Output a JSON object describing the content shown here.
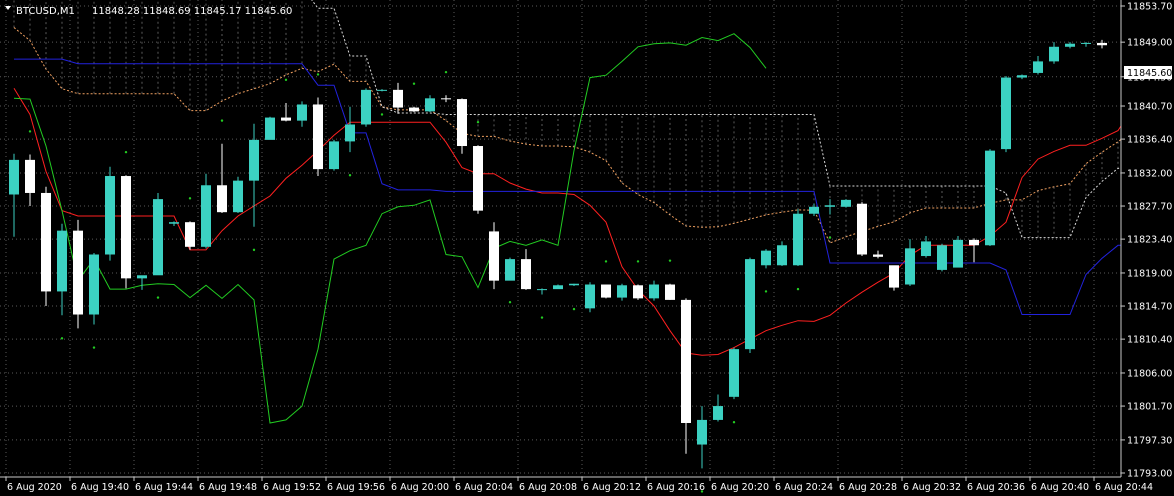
{
  "header": {
    "symbol": "BTCUSD,M1",
    "ohlc": "11848.28 11848.69 11845.17 11845.60"
  },
  "price_label": "11845.60",
  "colors": {
    "background": "#000000",
    "grid": "#5a5a5a",
    "bull_candle": "#3cd1c2",
    "bear_candle": "#ffffff",
    "tenkan": "#ff2020",
    "kijun": "#2222dd",
    "chikou": "#22cc22",
    "senkou_a": "#f0a060",
    "senkou_b": "#d8d8d8",
    "psar": "#22cc22"
  },
  "chart_data": {
    "type": "candlestick",
    "symbol": "BTCUSD",
    "timeframe": "M1",
    "indicators": [
      "Ichimoku Kinko Hyo",
      "Parabolic SAR"
    ],
    "ylim": [
      11793.0,
      11853.7
    ],
    "y_ticks": [
      "11853.70",
      "11849.00",
      "11845.60",
      "11844.50",
      "11840.70",
      "11836.40",
      "11832.00",
      "11827.70",
      "11823.40",
      "11819.00",
      "11814.70",
      "11810.40",
      "11806.00",
      "11801.70",
      "11797.30",
      "11793.00"
    ],
    "x_ticks": [
      "6 Aug 2020",
      "6 Aug 19:40",
      "6 Aug 19:44",
      "6 Aug 19:48",
      "6 Aug 19:52",
      "6 Aug 19:56",
      "6 Aug 20:00",
      "6 Aug 20:04",
      "6 Aug 20:08",
      "6 Aug 20:12",
      "6 Aug 20:16",
      "6 Aug 20:20",
      "6 Aug 20:24",
      "6 Aug 20:28",
      "6 Aug 20:32",
      "6 Aug 20:36",
      "6 Aug 20:40",
      "6 Aug 20:44"
    ],
    "candles": [
      {
        "o": 11829.2,
        "h": 11834.5,
        "l": 11823.7,
        "c": 11833.7
      },
      {
        "o": 11833.7,
        "h": 11834.4,
        "l": 11827.7,
        "c": 11829.4
      },
      {
        "o": 11829.4,
        "h": 11830.2,
        "l": 11814.7,
        "c": 11816.6
      },
      {
        "o": 11816.6,
        "h": 11825.4,
        "l": 11813.5,
        "c": 11824.5
      },
      {
        "o": 11824.5,
        "h": 11825.9,
        "l": 11811.8,
        "c": 11813.6
      },
      {
        "o": 11813.6,
        "h": 11821.6,
        "l": 11812.3,
        "c": 11821.4
      },
      {
        "o": 11821.4,
        "h": 11832.8,
        "l": 11820.6,
        "c": 11831.6
      },
      {
        "o": 11831.6,
        "h": 11831.7,
        "l": 11817.0,
        "c": 11818.3
      },
      {
        "o": 11818.3,
        "h": 11818.6,
        "l": 11816.8,
        "c": 11818.7
      },
      {
        "o": 11818.7,
        "h": 11829.4,
        "l": 11818.8,
        "c": 11828.6
      },
      {
        "o": 11825.4,
        "h": 11825.7,
        "l": 11825.1,
        "c": 11825.6
      },
      {
        "o": 11825.6,
        "h": 11825.7,
        "l": 11822.0,
        "c": 11822.4
      },
      {
        "o": 11822.4,
        "h": 11831.9,
        "l": 11822.2,
        "c": 11830.4
      },
      {
        "o": 11830.4,
        "h": 11835.8,
        "l": 11826.8,
        "c": 11826.9
      },
      {
        "o": 11826.9,
        "h": 11831.5,
        "l": 11826.8,
        "c": 11831.0
      },
      {
        "o": 11831.0,
        "h": 11838.4,
        "l": 11825.0,
        "c": 11836.3
      },
      {
        "o": 11836.3,
        "h": 11839.3,
        "l": 11836.5,
        "c": 11839.2
      },
      {
        "o": 11839.2,
        "h": 11841.1,
        "l": 11838.7,
        "c": 11838.8
      },
      {
        "o": 11838.8,
        "h": 11841.3,
        "l": 11838.0,
        "c": 11840.9
      },
      {
        "o": 11840.9,
        "h": 11841.8,
        "l": 11831.6,
        "c": 11832.5
      },
      {
        "o": 11832.5,
        "h": 11836.3,
        "l": 11832.3,
        "c": 11836.1
      },
      {
        "o": 11836.1,
        "h": 11840.6,
        "l": 11834.7,
        "c": 11838.3
      },
      {
        "o": 11838.3,
        "h": 11843.0,
        "l": 11838.0,
        "c": 11842.8
      },
      {
        "o": 11842.8,
        "h": 11842.9,
        "l": 11842.6,
        "c": 11842.8
      },
      {
        "o": 11842.8,
        "h": 11843.7,
        "l": 11839.7,
        "c": 11840.5
      },
      {
        "o": 11840.5,
        "h": 11840.6,
        "l": 11839.9,
        "c": 11840.0
      },
      {
        "o": 11840.0,
        "h": 11842.1,
        "l": 11839.9,
        "c": 11841.7
      },
      {
        "o": 11841.7,
        "h": 11842.1,
        "l": 11841.2,
        "c": 11841.6
      },
      {
        "o": 11841.6,
        "h": 11841.7,
        "l": 11834.5,
        "c": 11835.5
      },
      {
        "o": 11835.5,
        "h": 11835.6,
        "l": 11826.7,
        "c": 11827.1
      },
      {
        "o": 11824.4,
        "h": 11825.6,
        "l": 11816.9,
        "c": 11818.0
      },
      {
        "o": 11818.0,
        "h": 11821.0,
        "l": 11818.2,
        "c": 11820.8
      },
      {
        "o": 11820.8,
        "h": 11822.1,
        "l": 11816.8,
        "c": 11816.9
      },
      {
        "o": 11816.9,
        "h": 11817.0,
        "l": 11816.2,
        "c": 11816.9
      },
      {
        "o": 11816.9,
        "h": 11817.5,
        "l": 11817.2,
        "c": 11817.4
      },
      {
        "o": 11817.4,
        "h": 11817.6,
        "l": 11817.3,
        "c": 11817.6
      },
      {
        "o": 11814.4,
        "h": 11817.8,
        "l": 11813.9,
        "c": 11817.5
      },
      {
        "o": 11817.5,
        "h": 11817.5,
        "l": 11815.7,
        "c": 11815.8
      },
      {
        "o": 11815.8,
        "h": 11817.6,
        "l": 11815.4,
        "c": 11817.4
      },
      {
        "o": 11817.4,
        "h": 11817.5,
        "l": 11815.5,
        "c": 11815.7
      },
      {
        "o": 11815.7,
        "h": 11818.0,
        "l": 11815.4,
        "c": 11817.5
      },
      {
        "o": 11817.5,
        "h": 11817.6,
        "l": 11815.5,
        "c": 11815.5
      },
      {
        "o": 11815.5,
        "h": 11815.7,
        "l": 11795.5,
        "c": 11799.5
      },
      {
        "o": 11796.7,
        "h": 11801.7,
        "l": 11793.6,
        "c": 11799.9
      },
      {
        "o": 11799.9,
        "h": 11803.2,
        "l": 11799.7,
        "c": 11801.7
      },
      {
        "o": 11802.9,
        "h": 11809.3,
        "l": 11802.6,
        "c": 11809.1
      },
      {
        "o": 11809.1,
        "h": 11821.0,
        "l": 11808.6,
        "c": 11820.8
      },
      {
        "o": 11820.0,
        "h": 11822.1,
        "l": 11819.6,
        "c": 11821.9
      },
      {
        "o": 11820.0,
        "h": 11823.1,
        "l": 11819.9,
        "c": 11822.6
      },
      {
        "o": 11820.0,
        "h": 11827.3,
        "l": 11819.9,
        "c": 11826.7
      },
      {
        "o": 11826.7,
        "h": 11828.0,
        "l": 11826.4,
        "c": 11827.6
      },
      {
        "o": 11827.6,
        "h": 11828.6,
        "l": 11826.6,
        "c": 11827.8
      },
      {
        "o": 11827.6,
        "h": 11828.6,
        "l": 11827.5,
        "c": 11828.5
      },
      {
        "o": 11828.0,
        "h": 11828.2,
        "l": 11821.2,
        "c": 11821.4
      },
      {
        "o": 11821.4,
        "h": 11821.9,
        "l": 11820.9,
        "c": 11821.1
      },
      {
        "o": 11820.0,
        "h": 11819.7,
        "l": 11816.7,
        "c": 11817.1
      },
      {
        "o": 11817.5,
        "h": 11823.4,
        "l": 11817.3,
        "c": 11822.2
      },
      {
        "o": 11821.2,
        "h": 11823.8,
        "l": 11821.0,
        "c": 11823.1
      },
      {
        "o": 11819.4,
        "h": 11822.8,
        "l": 11819.2,
        "c": 11822.6
      },
      {
        "o": 11819.7,
        "h": 11823.8,
        "l": 11820.0,
        "c": 11823.3
      },
      {
        "o": 11823.3,
        "h": 11823.5,
        "l": 11820.4,
        "c": 11822.6
      },
      {
        "o": 11822.6,
        "h": 11835.1,
        "l": 11822.5,
        "c": 11834.9
      },
      {
        "o": 11835.1,
        "h": 11844.6,
        "l": 11834.7,
        "c": 11844.4
      },
      {
        "o": 11844.4,
        "h": 11844.8,
        "l": 11844.2,
        "c": 11844.7
      },
      {
        "o": 11845.0,
        "h": 11847.2,
        "l": 11844.8,
        "c": 11846.5
      },
      {
        "o": 11846.5,
        "h": 11849.0,
        "l": 11846.2,
        "c": 11848.4
      },
      {
        "o": 11848.4,
        "h": 11849.0,
        "l": 11848.2,
        "c": 11848.8
      },
      {
        "o": 11848.8,
        "h": 11849.0,
        "l": 11848.4,
        "c": 11848.9
      },
      {
        "o": 11848.9,
        "h": 11849.3,
        "l": 11848.2,
        "c": 11848.6
      },
      {
        "o": 11848.6,
        "h": 11849.8,
        "l": 11848.4,
        "c": 11849.6
      },
      {
        "o": 11849.6,
        "h": 11850.0,
        "l": 11848.0,
        "c": 11849.2
      },
      {
        "o": 11849.2,
        "h": 11850.3,
        "l": 11848.9,
        "c": 11850.1
      },
      {
        "o": 11850.1,
        "h": 11850.9,
        "l": 11848.0,
        "c": 11848.3
      },
      {
        "o": 11848.28,
        "h": 11848.69,
        "l": 11845.17,
        "c": 11845.6
      }
    ],
    "ichimoku": {
      "tenkan": [
        11843.0,
        11839.6,
        11832.2,
        11827.1,
        11826.4,
        11826.4,
        11826.4,
        11826.4,
        11826.4,
        11826.4,
        11826.4,
        11822.0,
        11822.0,
        11824.5,
        11826.4,
        11827.7,
        11829.0,
        11831.3,
        11833.0,
        11834.9,
        11836.9,
        11838.6,
        11838.6,
        11838.6,
        11838.6,
        11838.6,
        11838.6,
        11836.0,
        11832.7,
        11831.9,
        11831.9,
        11830.7,
        11829.9,
        11829.4,
        11829.4,
        11829.2,
        11827.8,
        11825.6,
        11819.8,
        11816.8,
        11814.7,
        11811.5,
        11808.6,
        11808.3,
        11808.4,
        11809.3,
        11810.4,
        11811.5,
        11812.2,
        11812.8,
        11812.7,
        11813.5,
        11815.1,
        11816.5,
        11817.8,
        11819.0,
        11821.3,
        11822.6,
        11822.6,
        11822.6,
        11822.6,
        11823.8,
        11825.6,
        11831.4,
        11833.8,
        11834.8,
        11835.6,
        11835.6,
        11836.5,
        11837.5,
        11840.7,
        11846.1,
        11848.0
      ],
      "kijun": [
        11846.8,
        11846.8,
        11846.8,
        11846.8,
        11846.2,
        11846.2,
        11846.2,
        11846.2,
        11846.2,
        11846.2,
        11846.2,
        11846.2,
        11846.2,
        11846.2,
        11846.2,
        11846.2,
        11846.2,
        11846.2,
        11846.2,
        11843.4,
        11843.4,
        11837.2,
        11837.2,
        11830.6,
        11829.8,
        11829.8,
        11829.8,
        11829.6,
        11829.6,
        11829.6,
        11829.6,
        11829.6,
        11829.6,
        11829.6,
        11829.6,
        11829.6,
        11829.6,
        11829.6,
        11829.6,
        11829.6,
        11829.6,
        11829.6,
        11829.6,
        11829.6,
        11829.6,
        11829.6,
        11829.6,
        11829.6,
        11829.6,
        11829.6,
        11829.6,
        11820.3,
        11820.3,
        11820.3,
        11820.3,
        11820.3,
        11820.3,
        11820.3,
        11820.3,
        11820.3,
        11820.3,
        11820.3,
        11819.4,
        11813.6,
        11813.6,
        11813.6,
        11813.6,
        11818.8,
        11820.9,
        11822.6,
        11822.6,
        11822.6,
        11825.7,
        11827.3,
        11829.1
      ]
    },
    "psar_count": 52
  }
}
